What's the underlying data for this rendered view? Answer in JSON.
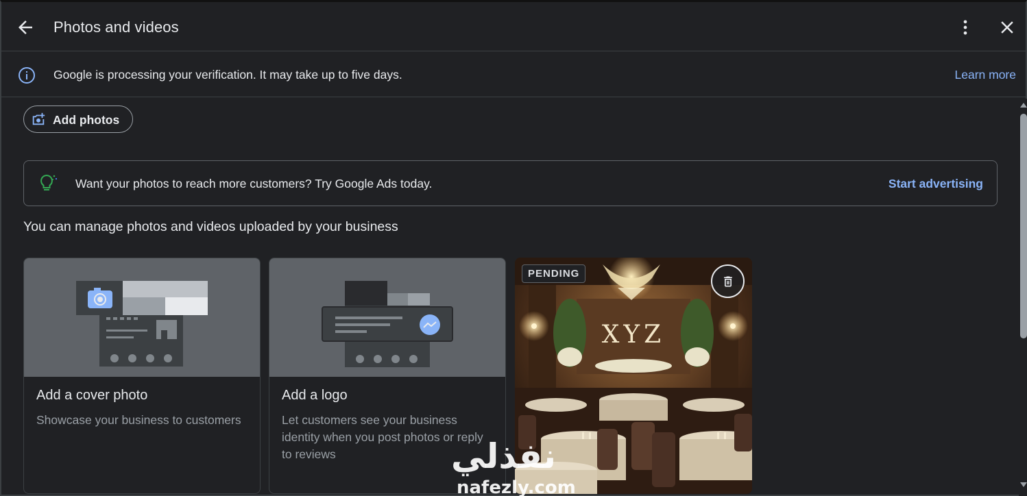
{
  "header": {
    "title": "Photos and videos"
  },
  "verification": {
    "message": "Google is processing your verification. It may take up to five days.",
    "link": "Learn more"
  },
  "add_photos": {
    "label": "Add photos"
  },
  "ads_card": {
    "message": "Want your photos to reach more customers? Try Google Ads today.",
    "link": "Start advertising"
  },
  "section_title": "You can manage photos and videos uploaded by your business",
  "tiles": [
    {
      "title": "Add a cover photo",
      "description": "Showcase your business to customers"
    },
    {
      "title": "Add a logo",
      "description": "Let customers see your business identity when you post photos or reply to reviews"
    }
  ],
  "photo": {
    "badge": "PENDING",
    "sign_text": "XYZ"
  },
  "watermark": {
    "arabic": "نفذلي",
    "latin": "nafezly.com"
  },
  "colors": {
    "background": "#202124",
    "link": "#8ab4f8",
    "border": "#3c4043",
    "text": "#e8eaed",
    "muted": "#9aa0a6",
    "accent_blue": "#8ab4f8",
    "bulb_green": "#34a853"
  },
  "icons": [
    "arrow-back-icon",
    "more-vert-icon",
    "close-icon",
    "info-icon",
    "add-photo-icon",
    "lightbulb-icon",
    "camera-icon",
    "delete-icon"
  ]
}
